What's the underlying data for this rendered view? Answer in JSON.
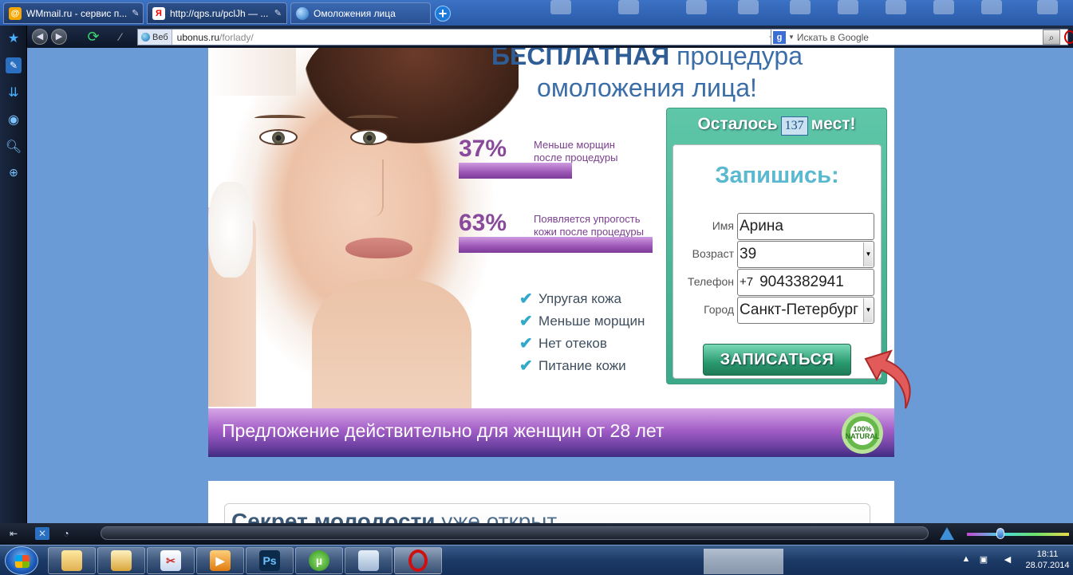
{
  "browser": {
    "tabs": [
      {
        "label": "WMmail.ru - сервис п...",
        "icon": "wmmail-icon"
      },
      {
        "label": "http://qps.ru/pclJh — ...",
        "icon": "yandex-icon"
      },
      {
        "label": "Омоложения лица",
        "icon": "globe-icon"
      }
    ],
    "web_label": "Веб",
    "url_host": "ubonus.ru",
    "url_path": "/forlady/",
    "search_placeholder": "Искать в Google",
    "search_engine_glyph": "g"
  },
  "page": {
    "headline_bold": "БЕСПЛАТНАЯ",
    "headline_rest": " процедура",
    "headline_line2": "омоложения лица!",
    "stats": [
      {
        "percent": "37%",
        "line1": "Меньше морщин",
        "line2": "после процедуры",
        "bar_fraction": 0.37
      },
      {
        "percent": "63%",
        "line1": "Появляется упрогость",
        "line2": "кожи после процедуры",
        "bar_fraction": 0.63
      }
    ],
    "benefits": [
      "Упругая кожа",
      "Меньше морщин",
      "Нет отеков",
      "Питание кожи"
    ],
    "form": {
      "remaining_prefix": "Осталось",
      "remaining_count": "137",
      "remaining_suffix": "мест!",
      "heading": "Запишись:",
      "fields": {
        "name_label": "Имя",
        "name_value": "Арина",
        "age_label": "Возраст",
        "age_value": "39",
        "phone_label": "Телефон",
        "phone_prefix": "+7",
        "phone_value": "9043382941",
        "city_label": "Город",
        "city_value": "Санкт-Петербург"
      },
      "submit_label": "ЗАПИСАТЬСЯ"
    },
    "banner_text": "Предложение действительно для женщин от 28 лет",
    "seal_text": "100% NATURAL",
    "section2_bold": "Секрет молодости",
    "section2_rest": " уже открыт"
  },
  "taskbar": {
    "time": "18:11",
    "date": "28.07.2014",
    "apps": [
      "folder-icon",
      "explorer-icon",
      "paint-icon",
      "media-player-icon",
      "photoshop-icon",
      "utorrent-icon",
      "notepad-icon",
      "opera-icon"
    ]
  }
}
